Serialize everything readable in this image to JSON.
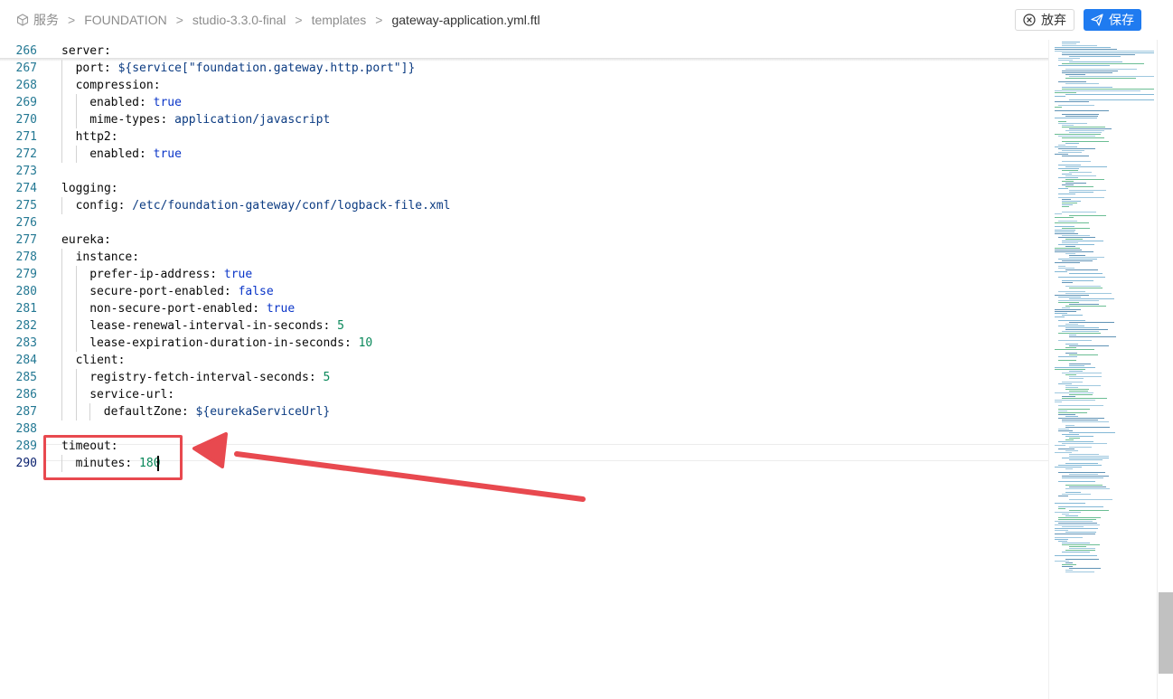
{
  "breadcrumb": {
    "items": [
      "服务",
      "FOUNDATION",
      "studio-3.3.0-final",
      "templates"
    ],
    "current": "gateway-application.yml.ftl",
    "separator": ">"
  },
  "toolbar": {
    "discard_label": "放弃",
    "save_label": "保存"
  },
  "editor": {
    "active_line": "290",
    "lines": [
      {
        "n": "266",
        "indent": 0,
        "key": "server",
        "sep": ":",
        "value": "",
        "vtype": ""
      },
      {
        "n": "267",
        "indent": 1,
        "key": "port",
        "sep": ": ",
        "value": "${service[\"foundation.gateway.http.port\"]}",
        "vtype": "str"
      },
      {
        "n": "268",
        "indent": 1,
        "key": "compression",
        "sep": ":",
        "value": "",
        "vtype": ""
      },
      {
        "n": "269",
        "indent": 2,
        "key": "enabled",
        "sep": ": ",
        "value": "true",
        "vtype": "bool"
      },
      {
        "n": "270",
        "indent": 2,
        "key": "mime-types",
        "sep": ": ",
        "value": "application/javascript",
        "vtype": "str"
      },
      {
        "n": "271",
        "indent": 1,
        "key": "http2",
        "sep": ":",
        "value": "",
        "vtype": ""
      },
      {
        "n": "272",
        "indent": 2,
        "key": "enabled",
        "sep": ": ",
        "value": "true",
        "vtype": "bool"
      },
      {
        "n": "273",
        "indent": 0,
        "key": "",
        "sep": "",
        "value": "",
        "vtype": ""
      },
      {
        "n": "274",
        "indent": 0,
        "key": "logging",
        "sep": ":",
        "value": "",
        "vtype": ""
      },
      {
        "n": "275",
        "indent": 1,
        "key": "config",
        "sep": ": ",
        "value": "/etc/foundation-gateway/conf/logback-file.xml",
        "vtype": "str"
      },
      {
        "n": "276",
        "indent": 0,
        "key": "",
        "sep": "",
        "value": "",
        "vtype": ""
      },
      {
        "n": "277",
        "indent": 0,
        "key": "eureka",
        "sep": ":",
        "value": "",
        "vtype": ""
      },
      {
        "n": "278",
        "indent": 1,
        "key": "instance",
        "sep": ":",
        "value": "",
        "vtype": ""
      },
      {
        "n": "279",
        "indent": 2,
        "key": "prefer-ip-address",
        "sep": ": ",
        "value": "true",
        "vtype": "bool"
      },
      {
        "n": "280",
        "indent": 2,
        "key": "secure-port-enabled",
        "sep": ": ",
        "value": "false",
        "vtype": "bool"
      },
      {
        "n": "281",
        "indent": 2,
        "key": "non-secure-port-enabled",
        "sep": ": ",
        "value": "true",
        "vtype": "bool"
      },
      {
        "n": "282",
        "indent": 2,
        "key": "lease-renewal-interval-in-seconds",
        "sep": ": ",
        "value": "5",
        "vtype": "num"
      },
      {
        "n": "283",
        "indent": 2,
        "key": "lease-expiration-duration-in-seconds",
        "sep": ": ",
        "value": "10",
        "vtype": "num"
      },
      {
        "n": "284",
        "indent": 1,
        "key": "client",
        "sep": ":",
        "value": "",
        "vtype": ""
      },
      {
        "n": "285",
        "indent": 2,
        "key": "registry-fetch-interval-seconds",
        "sep": ": ",
        "value": "5",
        "vtype": "num"
      },
      {
        "n": "286",
        "indent": 2,
        "key": "service-url",
        "sep": ":",
        "value": "",
        "vtype": ""
      },
      {
        "n": "287",
        "indent": 3,
        "key": "defaultZone",
        "sep": ": ",
        "value": "${eurekaServiceUrl}",
        "vtype": "str"
      },
      {
        "n": "288",
        "indent": 0,
        "key": "",
        "sep": "",
        "value": "",
        "vtype": ""
      },
      {
        "n": "289",
        "indent": 0,
        "key": "timeout",
        "sep": ":",
        "value": "",
        "vtype": ""
      },
      {
        "n": "290",
        "indent": 1,
        "key": "minutes",
        "sep": ": ",
        "value": "180",
        "vtype": "num"
      }
    ]
  },
  "colors": {
    "accent": "#1f7bf0",
    "annotation": "#e8494f",
    "line_number": "#237893",
    "bool": "#0a35c8",
    "number": "#09885a",
    "string": "#0b3b82"
  }
}
